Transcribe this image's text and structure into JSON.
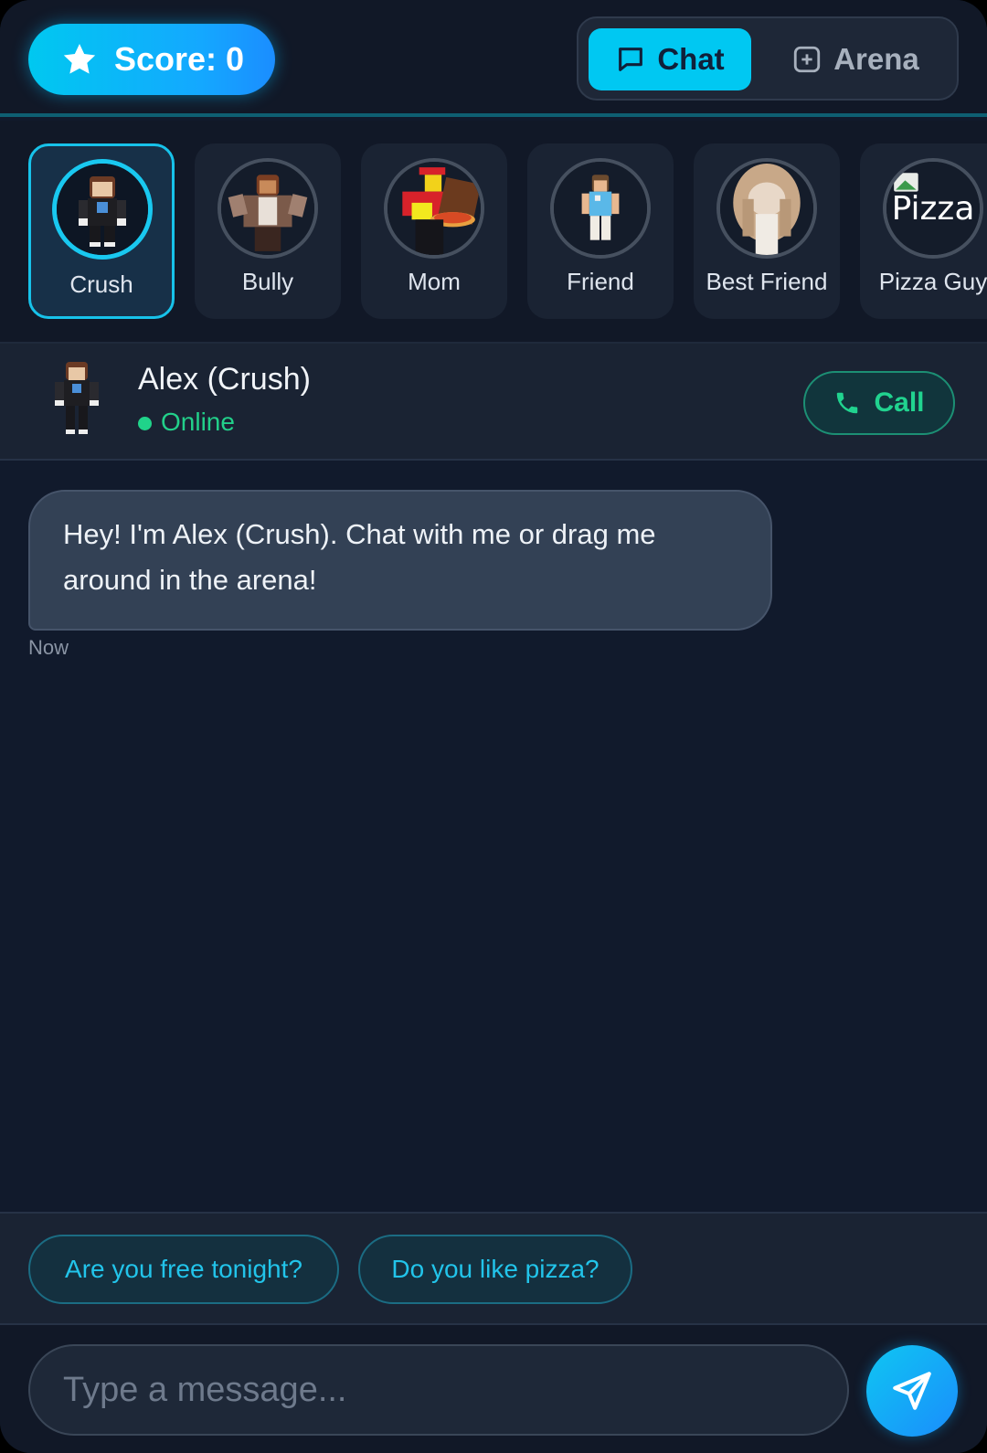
{
  "header": {
    "score_label": "Score: 0",
    "tabs": [
      {
        "label": "Chat",
        "icon": "chat-bubble-icon",
        "active": true
      },
      {
        "label": "Arena",
        "icon": "plus-square-icon",
        "active": false
      }
    ]
  },
  "contacts": [
    {
      "name": "Crush",
      "active": true
    },
    {
      "name": "Bully",
      "active": false
    },
    {
      "name": "Mom",
      "active": false
    },
    {
      "name": "Friend",
      "active": false
    },
    {
      "name": "Best Friend",
      "active": false
    },
    {
      "name": "Pizza Guy",
      "active": false,
      "avatar_text": "Pizza"
    }
  ],
  "chat": {
    "name": "Alex (Crush)",
    "status": "Online",
    "call_label": "Call"
  },
  "messages": [
    {
      "text": "Hey! I'm Alex (Crush). Chat with me or drag me around in the arena!",
      "time": "Now"
    }
  ],
  "quick_replies": [
    "Are you free tonight?",
    "Do you like pizza?"
  ],
  "input": {
    "placeholder": "Type a message..."
  },
  "colors": {
    "accent": "#00c8f2",
    "online": "#22d08a",
    "background": "#111a2c"
  }
}
